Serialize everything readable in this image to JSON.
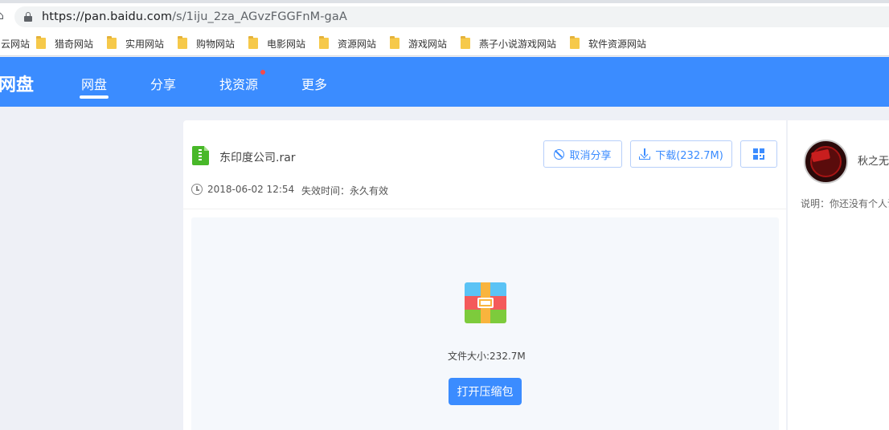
{
  "browser": {
    "url_host": "https://pan.baidu.com",
    "url_path": "/s/1iju_2za_AGvzFGGFnM-gaA",
    "bookmarks": [
      "云网站",
      "猎奇网站",
      "实用网站",
      "购物网站",
      "电影网站",
      "资源网站",
      "游戏网站",
      "燕子小说游戏网站",
      "软件资源网站"
    ]
  },
  "header": {
    "brand": "网盘",
    "nav": [
      "网盘",
      "分享",
      "找资源",
      "更多"
    ],
    "active_nav": "网盘"
  },
  "file": {
    "name": "东印度公司.rar",
    "date": "2018-06-02 12:54",
    "expiry": "失效时间：永久有效",
    "size_label": "文件大小:232.7M"
  },
  "actions": {
    "cancel_share": "取消分享",
    "download": "下载(232.7M)",
    "open_archive": "打开压缩包"
  },
  "side": {
    "username": "秋之无",
    "description": "说明：你还没有个人说"
  },
  "colors": {
    "brand_blue": "#3b8cff",
    "page_bg": "#eef0f6",
    "notification_dot": "#f54b4b"
  }
}
